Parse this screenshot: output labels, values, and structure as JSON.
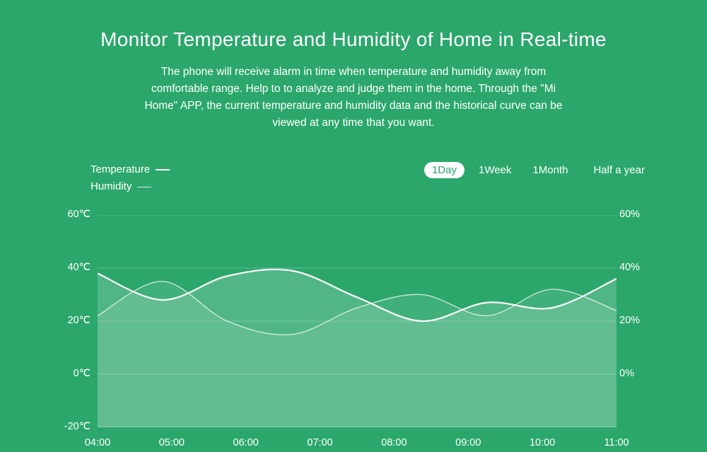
{
  "title": "Monitor Temperature and Humidity of Home in Real-time",
  "subtitle": "The phone will receive alarm in time when temperature and humidity away from comfortable range. Help to to analyze and judge them in the home. Through the \"Mi Home\" APP, the current temperature and humidity data and the historical curve can be viewed at any time that you want.",
  "legend": {
    "temperature": "Temperature",
    "humidity": "Humidity"
  },
  "tabs": {
    "day": "1Day",
    "week": "1Week",
    "month": "1Month",
    "half_year": "Half a year",
    "active": "day"
  },
  "colors": {
    "bg": "#2BA76B",
    "line": "#FFFFFF"
  },
  "chart_data": {
    "type": "line",
    "title": "Temperature and Humidity — 1 Day",
    "xlabel": "",
    "x": [
      "04:00",
      "05:00",
      "06:00",
      "07:00",
      "08:00",
      "09:00",
      "10:00",
      "11:00"
    ],
    "left_axis": {
      "label": "Temperature",
      "unit": "℃",
      "ticks": [
        -20,
        0,
        20,
        40,
        60
      ],
      "ylim": [
        -20,
        60
      ]
    },
    "right_axis": {
      "label": "Humidity",
      "unit": "%",
      "ticks": [
        0,
        20,
        40,
        60
      ],
      "ylim": [
        -20,
        60
      ]
    },
    "series": [
      {
        "name": "Temperature",
        "axis": "left",
        "values": [
          38,
          28,
          37,
          39,
          29,
          20,
          27,
          25,
          36
        ]
      },
      {
        "name": "Humidity",
        "axis": "right",
        "values": [
          22,
          35,
          20,
          15,
          25,
          30,
          22,
          32,
          24
        ]
      }
    ]
  }
}
